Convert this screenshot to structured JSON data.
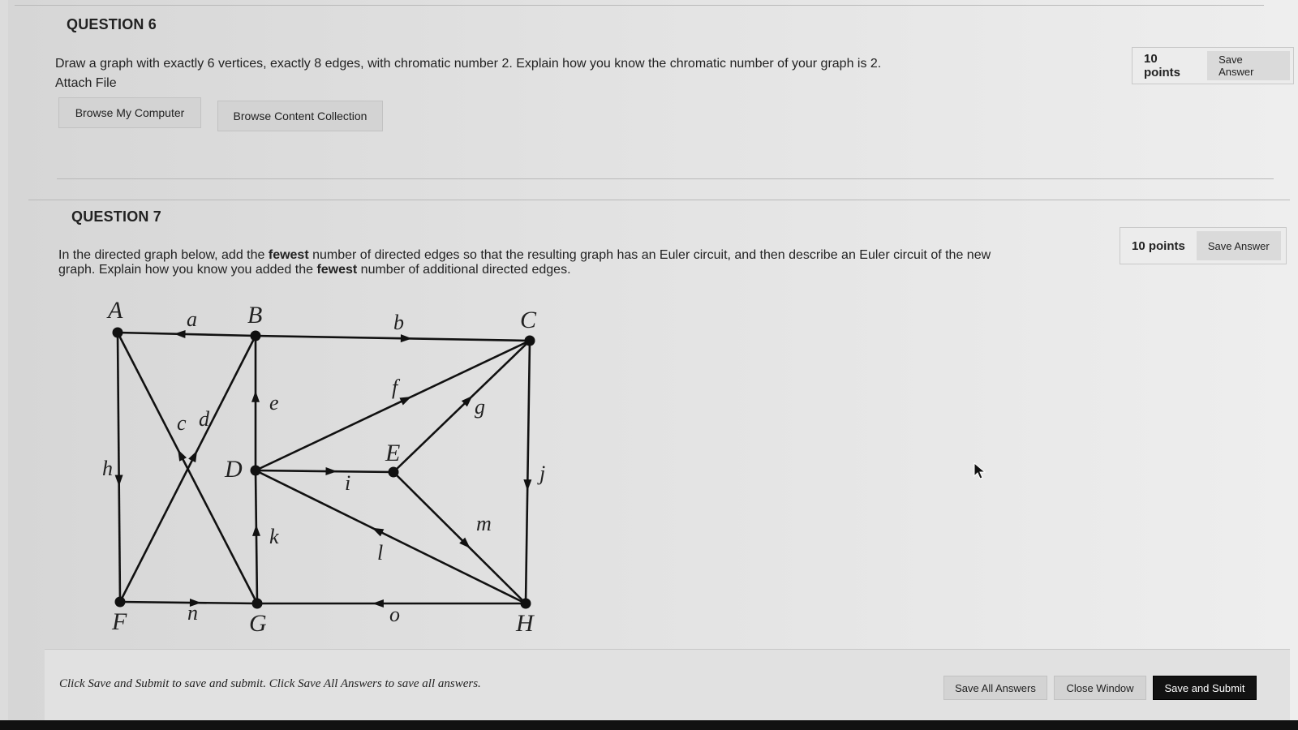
{
  "question6": {
    "title": "QUESTION 6",
    "text": "Draw a graph with exactly 6 vertices, exactly 8 edges, with chromatic number 2. Explain how you know the chromatic number of your graph is 2.",
    "attach_label": "Attach File",
    "browse_computer": "Browse My Computer",
    "browse_content": "Browse Content Collection",
    "points": "10 points",
    "save_answer": "Save Answer"
  },
  "question7": {
    "title": "QUESTION 7",
    "text_parts": [
      "In the directed graph below, add the ",
      "fewest",
      " number of directed edges so that the resulting graph has an Euler circuit, and then describe an Euler circuit of the new graph. Explain how you know you added the ",
      "fewest",
      " number of additional directed edges."
    ],
    "points": "10 points",
    "save_answer": "Save Answer",
    "graph": {
      "vertices": {
        "A": {
          "label": "A"
        },
        "B": {
          "label": "B"
        },
        "C": {
          "label": "C"
        },
        "D": {
          "label": "D"
        },
        "E": {
          "label": "E"
        },
        "F": {
          "label": "F"
        },
        "G": {
          "label": "G"
        },
        "H": {
          "label": "H"
        }
      },
      "edges": [
        {
          "id": "a",
          "label": "a",
          "from": "B",
          "to": "A"
        },
        {
          "id": "b",
          "label": "b",
          "from": "B",
          "to": "C"
        },
        {
          "id": "c",
          "label": "c",
          "from": "G",
          "to": "A"
        },
        {
          "id": "d",
          "label": "d",
          "from": "F",
          "to": "B"
        },
        {
          "id": "e",
          "label": "e",
          "from": "D",
          "to": "B"
        },
        {
          "id": "f",
          "label": "f",
          "from": "D",
          "to": "C"
        },
        {
          "id": "g",
          "label": "g",
          "from": "E",
          "to": "C"
        },
        {
          "id": "h",
          "label": "h",
          "from": "A",
          "to": "F"
        },
        {
          "id": "i",
          "label": "i",
          "from": "D",
          "to": "E"
        },
        {
          "id": "j",
          "label": "j",
          "from": "C",
          "to": "H"
        },
        {
          "id": "k",
          "label": "k",
          "from": "G",
          "to": "D"
        },
        {
          "id": "l",
          "label": "l",
          "from": "H",
          "to": "D"
        },
        {
          "id": "m",
          "label": "m",
          "from": "E",
          "to": "H"
        },
        {
          "id": "n",
          "label": "n",
          "from": "F",
          "to": "G"
        },
        {
          "id": "o",
          "label": "o",
          "from": "H",
          "to": "G"
        }
      ]
    }
  },
  "footer": {
    "note": "Click Save and Submit to save and submit. Click Save All Answers to save all answers.",
    "save_all": "Save All Answers",
    "close_window": "Close Window",
    "save_submit": "Save and Submit"
  }
}
